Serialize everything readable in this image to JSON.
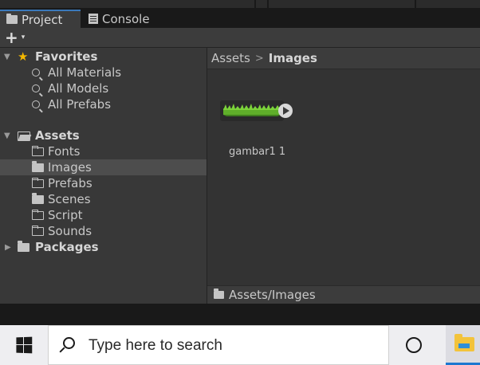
{
  "window": {
    "tabs": [
      {
        "label": "Project",
        "icon": "folder-icon",
        "active": true
      },
      {
        "label": "Console",
        "icon": "console-icon",
        "active": false
      }
    ],
    "accent": "#3a79bb"
  },
  "toolbar": {
    "add_label": "+",
    "add_caret": "▾"
  },
  "tree": {
    "favorites": {
      "label": "Favorites",
      "items": [
        "All Materials",
        "All Models",
        "All Prefabs"
      ]
    },
    "assets": {
      "label": "Assets",
      "items": [
        "Fonts",
        "Images",
        "Prefabs",
        "Scenes",
        "Script",
        "Sounds"
      ],
      "selected": "Images"
    },
    "packages": {
      "label": "Packages"
    }
  },
  "browser": {
    "breadcrumb": {
      "root": "Assets",
      "separator": ">",
      "current": "Images"
    },
    "assets": [
      {
        "name": "gambar1 1",
        "type": "sprite-thumbnail"
      }
    ],
    "path": "Assets/Images"
  },
  "taskbar": {
    "search_placeholder": "Type here to search",
    "icons": [
      "windows-start-icon",
      "search-icon",
      "cortana-icon",
      "file-explorer-icon"
    ]
  }
}
